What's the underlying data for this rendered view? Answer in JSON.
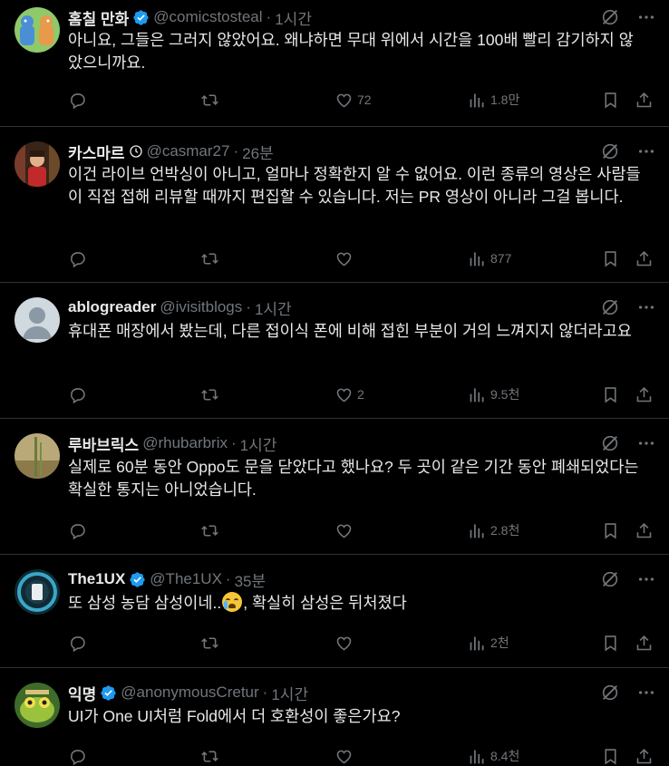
{
  "tweets": [
    {
      "name": "홈칠 만화",
      "handle": "@comicstosteal",
      "time": "1시간",
      "verified": true,
      "text": "아니요, 그들은 그러지 않았어요. 왜냐하면 무대 위에서 시간을 100배 빨리 감기하지 않았으니까요.",
      "likes": "72",
      "views": "1.8만"
    },
    {
      "name": "카스마르",
      "handle": "@casmar27",
      "time": "26분",
      "verified": false,
      "text": "이건 라이브 언박싱이 아니고, 얼마나 정확한지 알 수 없어요. 이런 종류의 영상은 사람들이 직접 접해 리뷰할 때까지 편집할 수 있습니다. 저는 PR 영상이 아니라 그걸 봅니다.",
      "likes": "",
      "views": "877"
    },
    {
      "name": "ablogreader",
      "handle": "@ivisitblogs",
      "time": "1시간",
      "verified": false,
      "text": "휴대폰 매장에서 봤는데, 다른 접이식 폰에 비해 접힌 부분이 거의 느껴지지 않더라고요",
      "likes": "2",
      "views": "9.5천"
    },
    {
      "name": "루바브릭스",
      "handle": "@rhubarbrix",
      "time": "1시간",
      "verified": false,
      "text": "실제로 60분 동안 Oppo도 문을 닫았다고 했나요? 두 곳이 같은 기간 동안 폐쇄되었다는 확실한 통지는 아니었습니다.",
      "likes": "",
      "views": "2.8천"
    },
    {
      "name": "The1UX",
      "handle": "@The1UX",
      "time": "35분",
      "verified": false,
      "text_before": "또 삼성 농담 삼성이네..",
      "emoji": "loudly-crying-face",
      "text_after": ", 확실히 삼성은 뒤처졌다",
      "likes": "",
      "views": "2천"
    },
    {
      "name": "익명",
      "handle": "@anonymousCretur",
      "time": "1시간",
      "verified": true,
      "text": "UI가 One UI처럼 Fold에서 더 호환성이 좋은가요?",
      "likes": "",
      "views": "8.4천"
    }
  ],
  "colors": {
    "background": "#000000",
    "text": "#e7e9ea",
    "muted": "#71767b",
    "verified": "#1d9bf0",
    "divider": "#2f3336"
  }
}
